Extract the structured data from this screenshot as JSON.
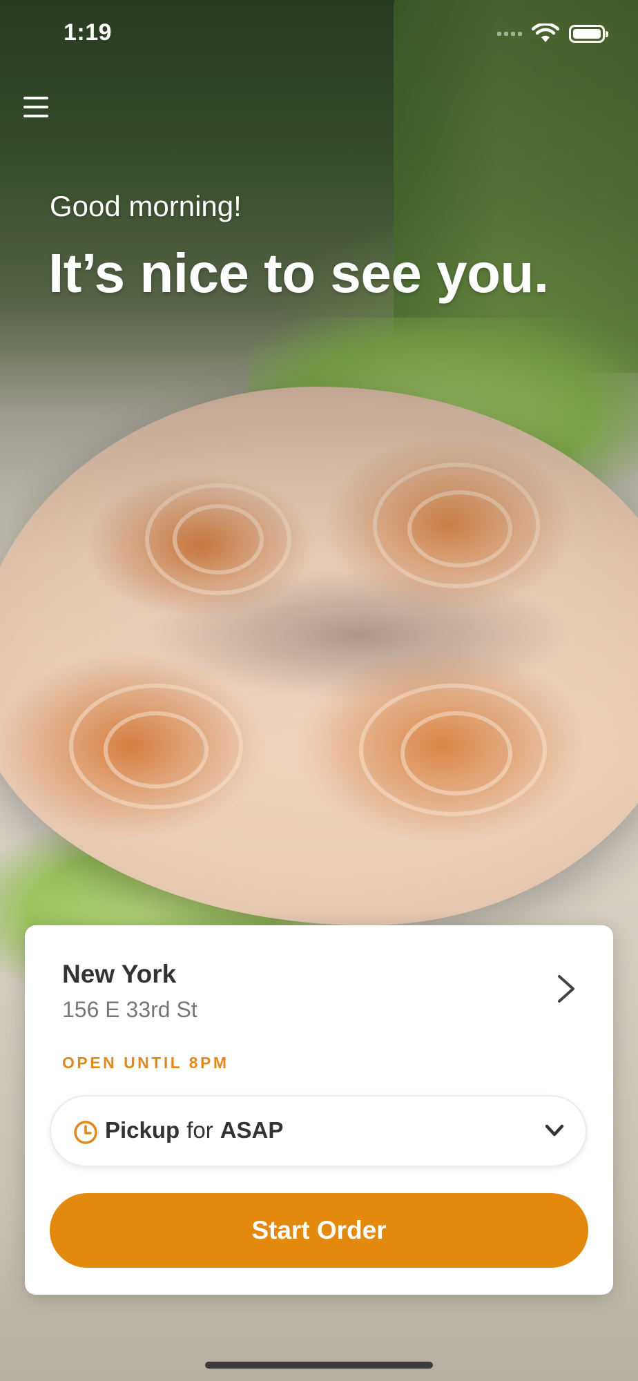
{
  "status_bar": {
    "time": "1:19"
  },
  "greeting": "Good morning!",
  "headline": "It’s nice to see you.",
  "location": {
    "name": "New York",
    "address": "156 E 33rd St",
    "hours": "OPEN UNTIL 8PM"
  },
  "order_mode": {
    "type": "Pickup",
    "connector": "for",
    "time": "ASAP"
  },
  "start_button_label": "Start Order",
  "colors": {
    "accent": "#e3890d",
    "accent_text": "#e0891a"
  },
  "icons": [
    "menu-icon",
    "wifi-icon",
    "battery-icon",
    "chevron-right-icon",
    "clock-icon",
    "chevron-down-icon"
  ]
}
